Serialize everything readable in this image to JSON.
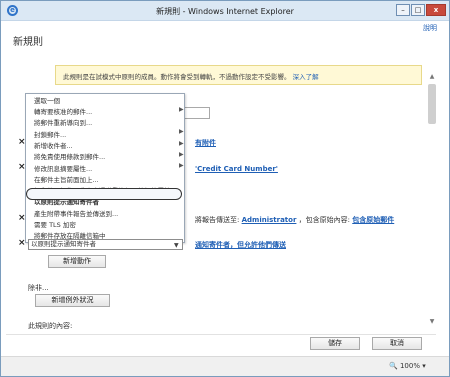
{
  "window": {
    "title": "新規則 - Windows Internet Explorer",
    "minimize": "–",
    "maximize": "□",
    "close": "x"
  },
  "page": {
    "title": "新規則",
    "help_link": "說明"
  },
  "notice": {
    "text": "此規則是在試模式中原則的成員。動作將會受到轉軌，不過動作設定不受影響。",
    "link": "深入了解"
  },
  "menu": {
    "items": [
      {
        "label": "選取一個",
        "has_submenu": false
      },
      {
        "label": "轉寄要核准的郵件...",
        "has_submenu": true
      },
      {
        "label": "將郵件重新導向到...",
        "has_submenu": false
      },
      {
        "label": "封鎖郵件...",
        "has_submenu": true
      },
      {
        "label": "新增收件者...",
        "has_submenu": true
      },
      {
        "label": "將免責使用條款到郵件...",
        "has_submenu": true
      },
      {
        "label": "修改訊息摘要屬性...",
        "has_submenu": true
      },
      {
        "label": "在郵件主旨前面加上...",
        "has_submenu": false
      },
      {
        "label": "設郵件預設為至非安全通道重複加以註記的屬性",
        "has_submenu": false
      },
      {
        "label": "以原則提示通知寄件者",
        "has_submenu": false
      },
      {
        "label": "產生附帶事件報告並傳送到...",
        "has_submenu": false
      },
      {
        "label": "需要 TLS 加密",
        "has_submenu": false
      },
      {
        "label": "將郵件存放在隔離信箱中",
        "has_submenu": false
      }
    ],
    "selected_index": 9
  },
  "rule": {
    "link_attachments": "有附件",
    "text_pattern": "'Credit Card Number'",
    "report_prefix": "將報告傳送至:",
    "report_recipient": "Administrator",
    "report_mid": "，包含原始內容:",
    "report_content": "包含原始郵件",
    "notify_link": "通知寄件者，但允許他們傳送"
  },
  "action_select": {
    "value": "以原則提示通知寄件者"
  },
  "buttons": {
    "add_action": "新增動作",
    "except_label": "除非...",
    "add_exception": "新增例外狀況",
    "properties_label": "此規則的內容:",
    "save": "儲存",
    "cancel": "取消"
  },
  "status": {
    "zoom": "100%"
  }
}
